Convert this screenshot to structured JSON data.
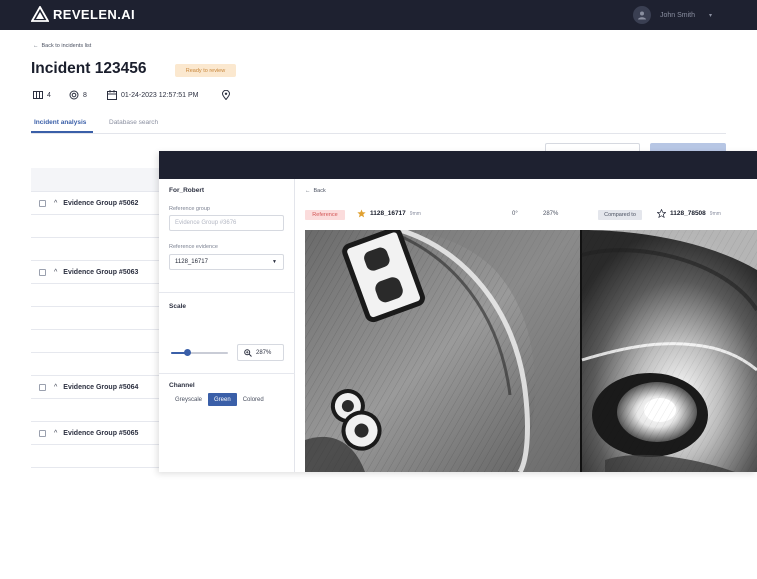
{
  "brand": {
    "name": "REVELEN.AI"
  },
  "user": {
    "name": "John Smith"
  },
  "page": {
    "back_link": "Back to incidents list",
    "title": "Incident 123456",
    "status": "Ready to review",
    "meta": {
      "evidence_count": "4",
      "sample_count": "8",
      "datetime": "01-24-2023 12:57:51 PM"
    },
    "tabs": [
      "Incident analysis",
      "Database search"
    ],
    "groups": [
      "Evidence Group #5062",
      "Evidence Group #5063",
      "Evidence Group #5064",
      "Evidence Group #5065"
    ]
  },
  "compare": {
    "panel_title": "For_Robert",
    "reference_group_label": "Reference group",
    "reference_group_value": "Evidence Group #3676",
    "reference_evidence_label": "Reference evidence",
    "reference_evidence_value": "1128_16717",
    "scale_label": "Scale",
    "scale_percent": 287,
    "scale_value": "287%",
    "channel_label": "Channel",
    "channels": [
      "Greyscale",
      "Green",
      "Colored"
    ],
    "active_channel": "Green",
    "back_label": "Back",
    "reference_badge": "Reference",
    "reference_id": "1128_16717",
    "reference_sub": "9mm",
    "rotation": "0°",
    "zoom": "287%",
    "compared_badge": "Compared to",
    "compared_id": "1128_78508",
    "compared_sub": "9mm"
  },
  "colors": {
    "accent": "#3a5fa8",
    "topbar": "#1e2130",
    "status_bg": "#fbe8cf",
    "reference_badge_bg": "#fbdcdc"
  },
  "icons": [
    "logo-mark-icon",
    "arrow-left-icon",
    "user-avatar-icon",
    "columns-icon",
    "target-icon",
    "calendar-icon",
    "location-pin-icon",
    "star-filled-icon",
    "star-outline-icon",
    "zoom-icon",
    "chevron-up-icon",
    "chevron-down-icon"
  ]
}
